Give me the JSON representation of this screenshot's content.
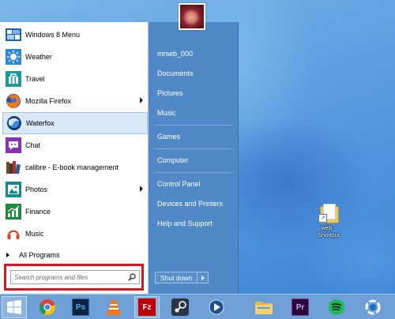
{
  "start_menu": {
    "programs": [
      {
        "label": "Windows 8 Menu",
        "icon": "windows8-menu-icon",
        "submenu": false
      },
      {
        "label": "Weather",
        "icon": "weather-icon",
        "submenu": false
      },
      {
        "label": "Travel",
        "icon": "travel-icon",
        "submenu": false
      },
      {
        "label": "Mozilla Firefox",
        "icon": "firefox-icon",
        "submenu": true
      },
      {
        "label": "Waterfox",
        "icon": "waterfox-icon",
        "submenu": false,
        "selected": true
      },
      {
        "label": "Chat",
        "icon": "chat-icon",
        "submenu": false
      },
      {
        "label": "calibre - E-book management",
        "icon": "calibre-icon",
        "submenu": false
      },
      {
        "label": "Photos",
        "icon": "photos-icon",
        "submenu": true
      },
      {
        "label": "Finance",
        "icon": "finance-icon",
        "submenu": false
      },
      {
        "label": "Music",
        "icon": "music-icon",
        "submenu": false
      }
    ],
    "all_programs": "All Programs",
    "search_placeholder": "Search programs and files",
    "right": {
      "username": "mrseb_000",
      "documents": "Documents",
      "pictures": "Pictures",
      "music": "Music",
      "games": "Games",
      "computer": "Computer",
      "control_panel": "Control Panel",
      "devices_printers": "Devices and Printers",
      "help_support": "Help and Support"
    },
    "shutdown_label": "Shut down"
  },
  "desktop": {
    "shortcut_label_line1": "web -",
    "shortcut_label_line2": "Shortcut"
  },
  "taskbar": {
    "ps_label": "Ps",
    "pr_label": "Pr",
    "fz_label": "Fz"
  },
  "colors": {
    "menu_right": "#5189c8",
    "highlight": "#d9141f",
    "taskbar": "#6e9fd6"
  }
}
